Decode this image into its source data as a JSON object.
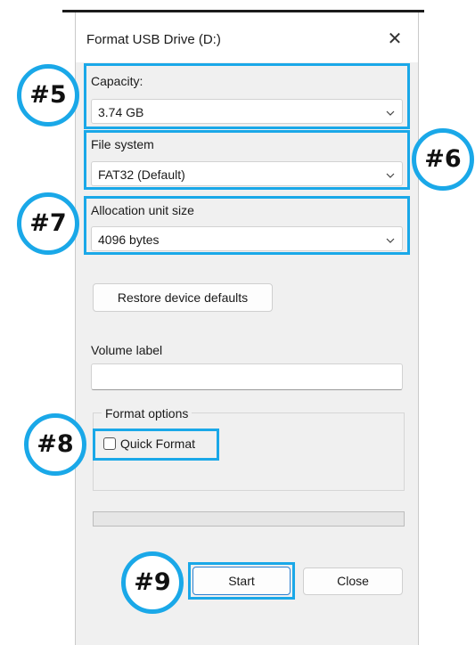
{
  "window": {
    "title": "Format USB Drive (D:)",
    "close_glyph": "✕"
  },
  "capacity": {
    "label": "Capacity:",
    "value": "3.74 GB"
  },
  "file_system": {
    "label": "File system",
    "value": "FAT32 (Default)"
  },
  "allocation": {
    "label": "Allocation unit size",
    "value": "4096 bytes"
  },
  "restore_button": "Restore device defaults",
  "volume_label": {
    "label": "Volume label",
    "value": ""
  },
  "format_options": {
    "legend": "Format options",
    "quick_format": {
      "label": "Quick Format",
      "checked": false
    }
  },
  "progress": {
    "value": 0
  },
  "buttons": {
    "start": "Start",
    "close": "Close"
  },
  "annotations": {
    "b5": "#5",
    "b6": "#6",
    "b7": "#7",
    "b8": "#8",
    "b9": "#9"
  },
  "colors": {
    "highlight": "#1aa8e8",
    "dialog_bg": "#f0f0f0"
  }
}
